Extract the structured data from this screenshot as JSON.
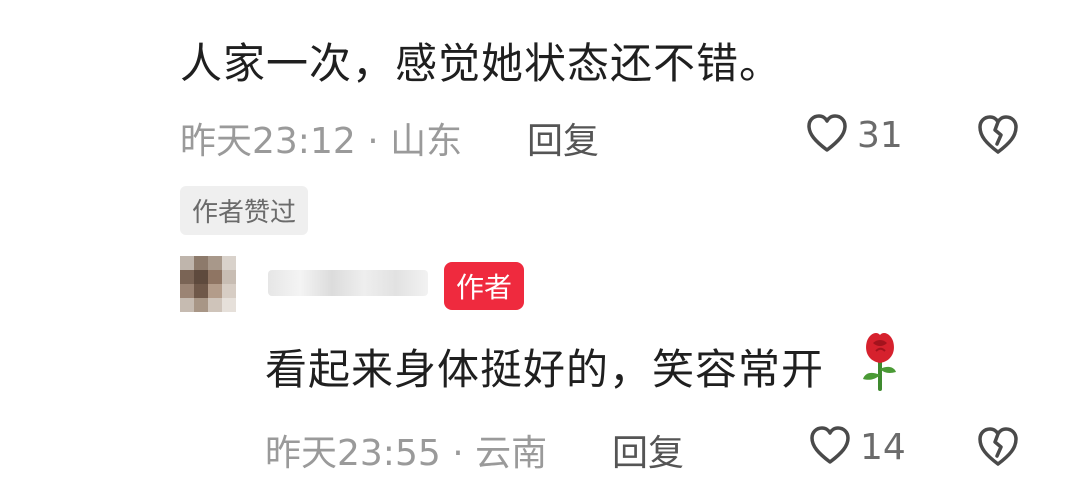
{
  "comment1": {
    "text": "人家一次，感觉她状态还不错。",
    "meta": "昨天23:12 · 山东",
    "reply_label": "回复",
    "like_count": "31",
    "badge": "作者赞过"
  },
  "comment2": {
    "author_badge": "作者",
    "text": "看起来身体挺好的，笑容常开",
    "meta": "昨天23:55 · 云南",
    "reply_label": "回复",
    "like_count": "14"
  },
  "colors": {
    "author_badge": "#ef2a3e",
    "rose": "#d6212d"
  },
  "icons": [
    "heart-outline-icon",
    "broken-heart-icon",
    "rose-icon"
  ]
}
